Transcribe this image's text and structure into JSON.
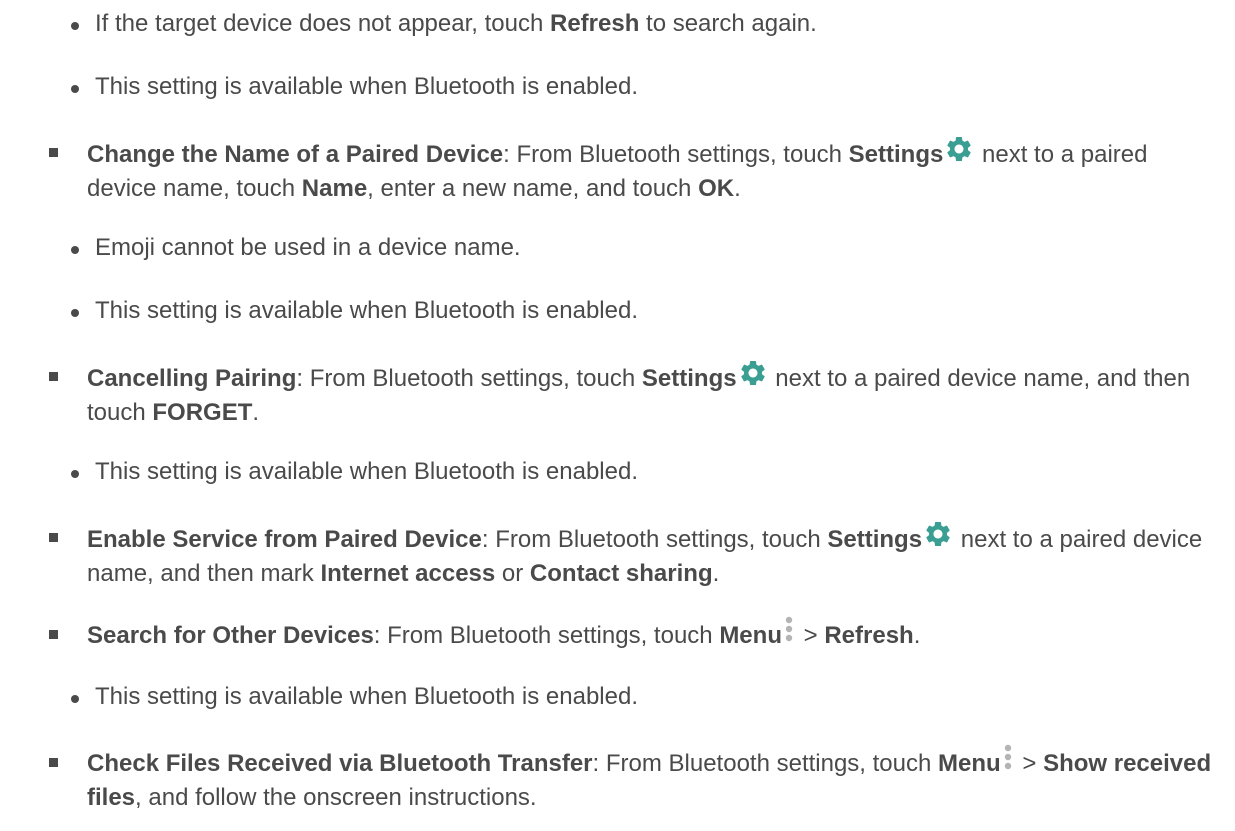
{
  "colors": {
    "text": "#4a4a4a",
    "gear_icon": "#3a9e93",
    "menu_icon": "#b4b4b4"
  },
  "items": [
    {
      "level": 2,
      "parts": [
        "If the target device does not appear, touch ",
        "Refresh",
        " to search again."
      ]
    },
    {
      "level": 2,
      "parts": [
        "This setting is available when Bluetooth is enabled."
      ]
    },
    {
      "level": 1,
      "parts": [
        "Change the Name of a Paired Device",
        ": From Bluetooth settings, touch ",
        "Settings",
        "gear-icon",
        " next to a paired device name, touch ",
        "Name",
        ", enter a new name, and touch ",
        "OK",
        "."
      ]
    },
    {
      "level": 2,
      "parts": [
        "Emoji cannot be used in a device name."
      ]
    },
    {
      "level": 2,
      "parts": [
        "This setting is available when Bluetooth is enabled."
      ]
    },
    {
      "level": 1,
      "parts": [
        "Cancelling Pairing",
        ": From Bluetooth settings, touch ",
        "Settings",
        "gear-icon",
        " next to a paired device name, and then touch ",
        "FORGET",
        "."
      ]
    },
    {
      "level": 2,
      "parts": [
        "This setting is available when Bluetooth is enabled."
      ]
    },
    {
      "level": 1,
      "parts": [
        "Enable Service from Paired Device",
        ": From Bluetooth settings, touch ",
        "Settings",
        "gear-icon",
        " next to a paired device name, and then mark ",
        "Internet access",
        " or ",
        "Contact sharing",
        "."
      ]
    },
    {
      "level": 1,
      "parts": [
        "Search for Other Devices",
        ": From Bluetooth settings, touch ",
        "Menu",
        "menu-icon",
        " > ",
        "Refresh",
        "."
      ]
    },
    {
      "level": 2,
      "parts": [
        "This setting is available when Bluetooth is enabled."
      ]
    },
    {
      "level": 1,
      "parts": [
        "Check Files Received via Bluetooth Transfer",
        ": From Bluetooth settings, touch ",
        "Menu",
        "menu-icon",
        " > ",
        "Show received files",
        ", and follow the onscreen instructions."
      ]
    }
  ]
}
